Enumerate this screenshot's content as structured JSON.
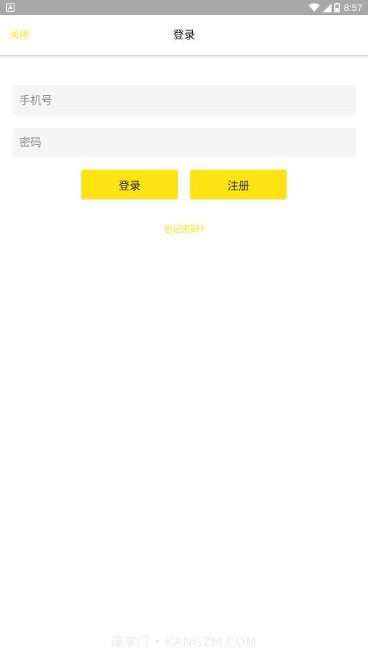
{
  "status_bar": {
    "time": "8:57",
    "icons": [
      "notification-a-icon",
      "wifi-icon",
      "cell-signal-icon",
      "battery-icon"
    ]
  },
  "toolbar": {
    "close_label": "关闭",
    "title": "登录"
  },
  "form": {
    "phone_placeholder": "手机号",
    "phone_value": "",
    "password_placeholder": "密码",
    "password_value": "",
    "login_label": "登录",
    "register_label": "注册",
    "forgot_label": "忘记密码?"
  },
  "watermark": "康掌门 • KANGZM.COM",
  "colors": {
    "accent": "#ffe313",
    "status_bar": "#a8a8a8",
    "input_bg": "#f5f5f5"
  }
}
